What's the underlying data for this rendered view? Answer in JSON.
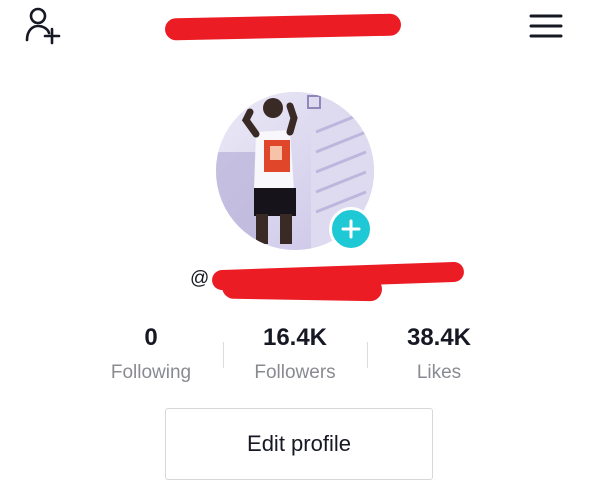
{
  "header": {
    "title": "g",
    "add_user_icon": "add-user-icon",
    "menu_icon": "hamburger-menu-icon"
  },
  "profile": {
    "avatar_icon": "add-photo-plus-icon",
    "at_prefix": "@",
    "username": "",
    "accent_color": "#1ec8d5",
    "redaction_color": "#ec1c24"
  },
  "stats": [
    {
      "value": "0",
      "label": "Following"
    },
    {
      "value": "16.4K",
      "label": "Followers"
    },
    {
      "value": "38.4K",
      "label": "Likes"
    }
  ],
  "actions": {
    "edit_profile_label": "Edit profile"
  }
}
